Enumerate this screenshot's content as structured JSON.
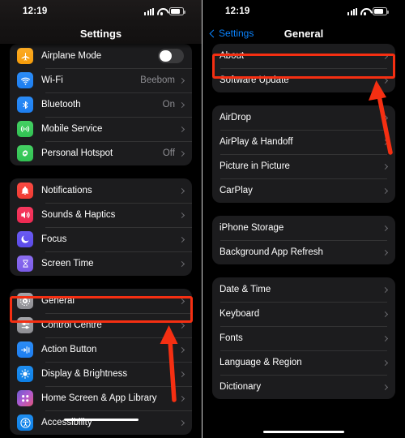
{
  "status_bar": {
    "time": "12:19",
    "signal": "cellular-bars-icon",
    "wifi": "wifi-icon",
    "battery": "battery-icon"
  },
  "left_panel": {
    "nav_title": "Settings",
    "groups": [
      {
        "rows": [
          {
            "icon": "airplane-icon",
            "label": "Airplane Mode",
            "value": "",
            "control": "toggle",
            "toggle_on": false
          },
          {
            "icon": "wifi-icon",
            "label": "Wi-Fi",
            "value": "Beebom",
            "control": "chevron"
          },
          {
            "icon": "bluetooth-icon",
            "label": "Bluetooth",
            "value": "On",
            "control": "chevron"
          },
          {
            "icon": "mobile-service-icon",
            "label": "Mobile Service",
            "value": "",
            "control": "chevron"
          },
          {
            "icon": "personal-hotspot-icon",
            "label": "Personal Hotspot",
            "value": "Off",
            "control": "chevron"
          }
        ]
      },
      {
        "rows": [
          {
            "icon": "notifications-icon",
            "label": "Notifications",
            "value": "",
            "control": "chevron"
          },
          {
            "icon": "sounds-haptics-icon",
            "label": "Sounds & Haptics",
            "value": "",
            "control": "chevron"
          },
          {
            "icon": "focus-icon",
            "label": "Focus",
            "value": "",
            "control": "chevron"
          },
          {
            "icon": "screen-time-icon",
            "label": "Screen Time",
            "value": "",
            "control": "chevron"
          }
        ]
      },
      {
        "rows": [
          {
            "icon": "general-icon",
            "label": "General",
            "value": "",
            "control": "chevron"
          },
          {
            "icon": "control-centre-icon",
            "label": "Control Centre",
            "value": "",
            "control": "chevron"
          },
          {
            "icon": "action-button-icon",
            "label": "Action Button",
            "value": "",
            "control": "chevron"
          },
          {
            "icon": "display-brightness-icon",
            "label": "Display & Brightness",
            "value": "",
            "control": "chevron"
          },
          {
            "icon": "home-screen-icon",
            "label": "Home Screen & App Library",
            "value": "",
            "control": "chevron"
          },
          {
            "icon": "accessibility-icon",
            "label": "Accessibility",
            "value": "",
            "control": "chevron"
          }
        ]
      }
    ]
  },
  "right_panel": {
    "back_label": "Settings",
    "nav_title": "General",
    "groups": [
      {
        "rows": [
          {
            "label": "About",
            "control": "chevron"
          },
          {
            "label": "Software Update",
            "control": "chevron"
          }
        ]
      },
      {
        "rows": [
          {
            "label": "AirDrop",
            "control": "chevron"
          },
          {
            "label": "AirPlay & Handoff",
            "control": "chevron"
          },
          {
            "label": "Picture in Picture",
            "control": "chevron"
          },
          {
            "label": "CarPlay",
            "control": "chevron"
          }
        ]
      },
      {
        "rows": [
          {
            "label": "iPhone Storage",
            "control": "chevron"
          },
          {
            "label": "Background App Refresh",
            "control": "chevron"
          }
        ]
      },
      {
        "rows": [
          {
            "label": "Date & Time",
            "control": "chevron"
          },
          {
            "label": "Keyboard",
            "control": "chevron"
          },
          {
            "label": "Fonts",
            "control": "chevron"
          },
          {
            "label": "Language & Region",
            "control": "chevron"
          },
          {
            "label": "Dictionary",
            "control": "chevron"
          }
        ]
      }
    ]
  },
  "annotations": {
    "highlight_color": "#f52f12",
    "left_highlight_target": "General",
    "right_highlight_target": "About",
    "left_arrow": "points-up-to-general",
    "right_arrow": "points-up-to-about"
  }
}
